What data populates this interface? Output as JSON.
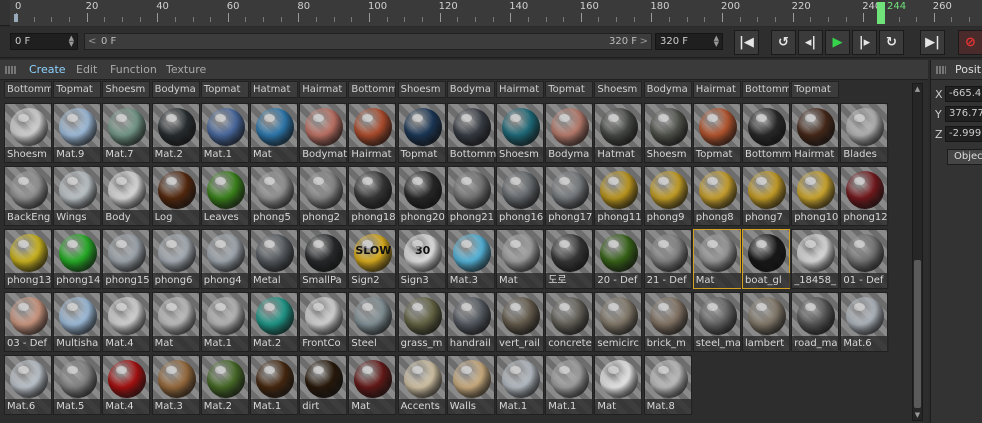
{
  "timeline": {
    "ticks": [
      "0",
      "20",
      "40",
      "60",
      "80",
      "100",
      "120",
      "140",
      "160",
      "180",
      "200",
      "220",
      "240",
      "260"
    ],
    "current_frame": "244"
  },
  "transport": {
    "current_field": "0 F",
    "range_start": "0 F",
    "range_end": "320 F",
    "end_field": "320 F",
    "prev_icon": "◀",
    "next_icon": "▶"
  },
  "material_manager": {
    "menu": [
      "Create",
      "Edit",
      "Function",
      "Texture"
    ],
    "header_row": [
      "Bottomm",
      "Topmat",
      "Shoesm",
      "Bodyma",
      "Topmat",
      "Hatmat",
      "Hairmat",
      "Bottomm",
      "Shoesm",
      "Bodyma",
      "Hairmat",
      "Topmat",
      "Shoesm",
      "Bodyma",
      "Hairmat",
      "Bottomm",
      "Topmat"
    ],
    "rows": [
      [
        {
          "label": "Shoesm",
          "color": "#e0e0e0"
        },
        {
          "label": "Mat.9",
          "color": "#a9c8e8"
        },
        {
          "label": "Mat.7",
          "color": "#7aa090"
        },
        {
          "label": "Mat.2",
          "color": "#2a3033"
        },
        {
          "label": "Mat.1",
          "color": "#4d6fa8"
        },
        {
          "label": "Mat",
          "color": "#2f7fb8"
        },
        {
          "label": "Bodymat",
          "color": "#c9786a"
        },
        {
          "label": "Hairmat",
          "color": "#b8502e"
        },
        {
          "label": "Topmat",
          "color": "#1c3a5c"
        },
        {
          "label": "Bottomm",
          "color": "#3a3f48"
        },
        {
          "label": "Shoesm",
          "color": "#1e7080"
        },
        {
          "label": "Bodyma",
          "color": "#c28272"
        },
        {
          "label": "Hatmat",
          "color": "#4a4d48"
        },
        {
          "label": "Shoesm",
          "color": "#55574f"
        },
        {
          "label": "Topmat",
          "color": "#c05a30"
        },
        {
          "label": "Bottomm",
          "color": "#2b2b2b"
        },
        {
          "label": "Hairmat",
          "color": "#4a2a1a"
        },
        {
          "label": "Blades",
          "color": "#bdbdbd"
        }
      ],
      [
        {
          "label": "BackEng",
          "color": "#9a9a9a"
        },
        {
          "label": "Wings",
          "color": "#c8d0d4"
        },
        {
          "label": "Body",
          "color": "#e8e8e8"
        },
        {
          "label": "Log",
          "color": "#5a2a0e"
        },
        {
          "label": "Leaves",
          "color": "#3d8a1c"
        },
        {
          "label": "phong5",
          "color": "#9a9a9a"
        },
        {
          "label": "phong2",
          "color": "#8f8f8f"
        },
        {
          "label": "phong18",
          "color": "#3a3a3a"
        },
        {
          "label": "phong20",
          "color": "#2a2a2a"
        },
        {
          "label": "phong21",
          "color": "#7a7a7a"
        },
        {
          "label": "phong16",
          "color": "#6a6f73"
        },
        {
          "label": "phong17",
          "color": "#7d8185"
        },
        {
          "label": "phong11",
          "color": "#c8a020"
        },
        {
          "label": "phong9",
          "color": "#d0a828"
        },
        {
          "label": "phong8",
          "color": "#d4aa30"
        },
        {
          "label": "phong7",
          "color": "#d0a628"
        },
        {
          "label": "phong10",
          "color": "#d8b030"
        },
        {
          "label": "phong12",
          "color": "#7a1a1e"
        }
      ],
      [
        {
          "label": "phong13",
          "color": "#d8c020"
        },
        {
          "label": "phong14",
          "color": "#28b828"
        },
        {
          "label": "phong15",
          "color": "#a8b0b8"
        },
        {
          "label": "phong6",
          "color": "#b0b8c0"
        },
        {
          "label": "phong4",
          "color": "#aab2ba"
        },
        {
          "label": "Metal",
          "color": "#5a6066"
        },
        {
          "label": "SmallPa",
          "color": "#2a2c2e"
        },
        {
          "label": "Sign2",
          "color": "#e8b820",
          "text": "SLOW"
        },
        {
          "label": "Sign3",
          "color": "#f0f0f0",
          "text": "30"
        },
        {
          "label": "Mat.3",
          "color": "#5ac0e8"
        },
        {
          "label": "Mat",
          "color": "#a8a8a8"
        },
        {
          "label": "도로",
          "color": "#3a3a3a"
        },
        {
          "label": "20 - Def",
          "color": "#3a6a18"
        },
        {
          "label": "21 - Def",
          "color": "#8a8a8a"
        },
        {
          "label": "Mat",
          "color": "#a0a0a0",
          "selected": true
        },
        {
          "label": "boat_gl",
          "color": "#1a1a1a",
          "selected": true
        },
        {
          "label": "_18458_",
          "color": "#e8e8e8"
        },
        {
          "label": "01 - Def",
          "color": "#7a7a7a"
        }
      ],
      [
        {
          "label": "03 - Def",
          "color": "#d8a088"
        },
        {
          "label": "Multisha",
          "color": "#a8c8e8"
        },
        {
          "label": "Mat.4",
          "color": "#e0e0e0"
        },
        {
          "label": "Mat",
          "color": "#c8c8c8"
        },
        {
          "label": "Mat.1",
          "color": "#c0c0c0"
        },
        {
          "label": "Mat.2",
          "color": "#20a090"
        },
        {
          "label": "FrontCo",
          "color": "#e0e0e0"
        },
        {
          "label": "Steel",
          "color": "#8a9aa0"
        },
        {
          "label": "grass_m",
          "color": "#6a6a48"
        },
        {
          "label": "handrail",
          "color": "#5a6068"
        },
        {
          "label": "vert_rail",
          "color": "#6a6050"
        },
        {
          "label": "concrete",
          "color": "#6a665e"
        },
        {
          "label": "semicirc",
          "color": "#8a8070"
        },
        {
          "label": "brick_m",
          "color": "#8a7a6a"
        },
        {
          "label": "steel_ma",
          "color": "#6a6a6a"
        },
        {
          "label": "lambert",
          "color": "#8a8070"
        },
        {
          "label": "road_ma",
          "color": "#5a5a5a"
        },
        {
          "label": "Mat.6",
          "color": "#b8c0c8"
        }
      ],
      [
        {
          "label": "Mat.6",
          "color": "#c8d0d8"
        },
        {
          "label": "Mat.5",
          "color": "#8a8a8a"
        },
        {
          "label": "Mat.4",
          "color": "#b01010"
        },
        {
          "label": "Mat.3",
          "color": "#a07040"
        },
        {
          "label": "Mat.2",
          "color": "#4a7028"
        },
        {
          "label": "Mat.1",
          "color": "#4a2a10"
        },
        {
          "label": "dirt",
          "color": "#2a1a0a"
        },
        {
          "label": "Mat",
          "color": "#6a1a18"
        },
        {
          "label": "Accents",
          "color": "#e0d0b0"
        },
        {
          "label": "Walls",
          "color": "#d8b888"
        },
        {
          "label": "Mat.1",
          "color": "#c0c8d0"
        },
        {
          "label": "Mat.1",
          "color": "#a8a8a8"
        },
        {
          "label": "Mat",
          "color": "#f8f8f8"
        },
        {
          "label": "Mat.8",
          "color": "#c8c8c8"
        }
      ]
    ]
  },
  "attributes": {
    "title": "Positi",
    "x_label": "X",
    "x_value": "-665.4",
    "y_label": "Y",
    "y_value": "376.77",
    "z_label": "Z",
    "z_value": "-2.999",
    "object_button": "Objec"
  }
}
